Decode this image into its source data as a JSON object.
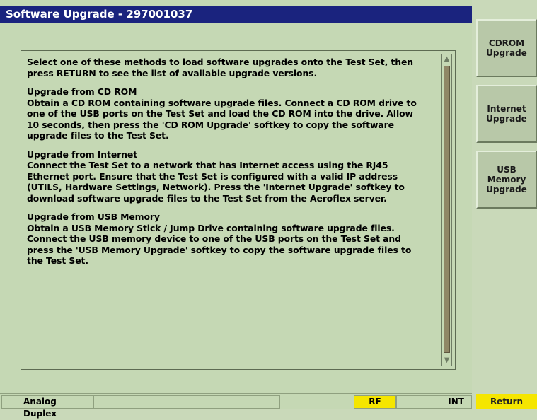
{
  "window": {
    "title": "Software Upgrade - 297001037"
  },
  "content": {
    "paragraphs": [
      "Select one of these methods to load software upgrades onto the Test Set, then\npress RETURN to see the list of available upgrade versions.",
      "Upgrade from CD ROM\nObtain a CD ROM containing software upgrade files. Connect a CD ROM drive to\none of the USB ports on the Test Set and load the CD ROM into the drive. Allow\n10 seconds, then press the 'CD ROM Upgrade' softkey to copy the software\nupgrade files to the Test Set.",
      "Upgrade from Internet\nConnect the Test Set to a network that has Internet access using the RJ45\nEthernet port. Ensure that the Test Set is configured with a valid IP address\n(UTILS, Hardware Settings, Network). Press the 'Internet Upgrade' softkey to\ndownload software upgrade files to the Test Set from the Aeroflex server.",
      "Upgrade from USB Memory\nObtain a USB Memory Stick / Jump Drive containing software upgrade files.\nConnect the USB memory device to one of the USB ports on the Test Set and\npress the 'USB Memory Upgrade' softkey to copy the software upgrade files to\nthe Test Set."
    ]
  },
  "softkeys": {
    "cdrom": "CDROM\nUpgrade",
    "internet": "Internet\nUpgrade",
    "usb": "USB\nMemory\nUpgrade",
    "return": "Return"
  },
  "status": {
    "mode": "Analog Duplex",
    "rf": "RF",
    "int": "INT"
  },
  "colors": {
    "titlebar": "#1a237e",
    "rf_indicator": "#f5e600",
    "background": "#c5d8b4"
  }
}
